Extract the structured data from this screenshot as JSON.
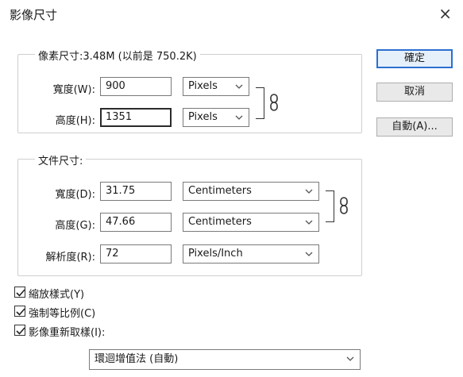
{
  "dialog": {
    "title": "影像尺寸",
    "close_glyph": "×"
  },
  "pixel_dimensions": {
    "legend": "像素尺寸:3.48M (以前是 750.2K)",
    "width_label": "寬度(W):",
    "width_value": "900",
    "width_unit": "Pixels",
    "height_label": "高度(H):",
    "height_value": "1351",
    "height_unit": "Pixels",
    "link_icon": "chain-link-icon"
  },
  "document_size": {
    "legend": "文件尺寸:",
    "width_label": "寬度(D):",
    "width_value": "31.75",
    "width_unit": "Centimeters",
    "height_label": "高度(G):",
    "height_value": "47.66",
    "height_unit": "Centimeters",
    "resolution_label": "解析度(R):",
    "resolution_value": "72",
    "resolution_unit": "Pixels/Inch",
    "link_icon": "chain-link-icon"
  },
  "buttons": {
    "ok": "確定",
    "cancel": "取消",
    "auto": "自動(A)..."
  },
  "options": {
    "scale_styles": {
      "label": "縮放樣式(Y)",
      "checked": true
    },
    "constrain_proportions": {
      "label": "強制等比例(C)",
      "checked": true
    },
    "resample_image": {
      "label": "影像重新取樣(I):",
      "checked": true
    },
    "resample_method": "環迴增值法 (自動)"
  }
}
